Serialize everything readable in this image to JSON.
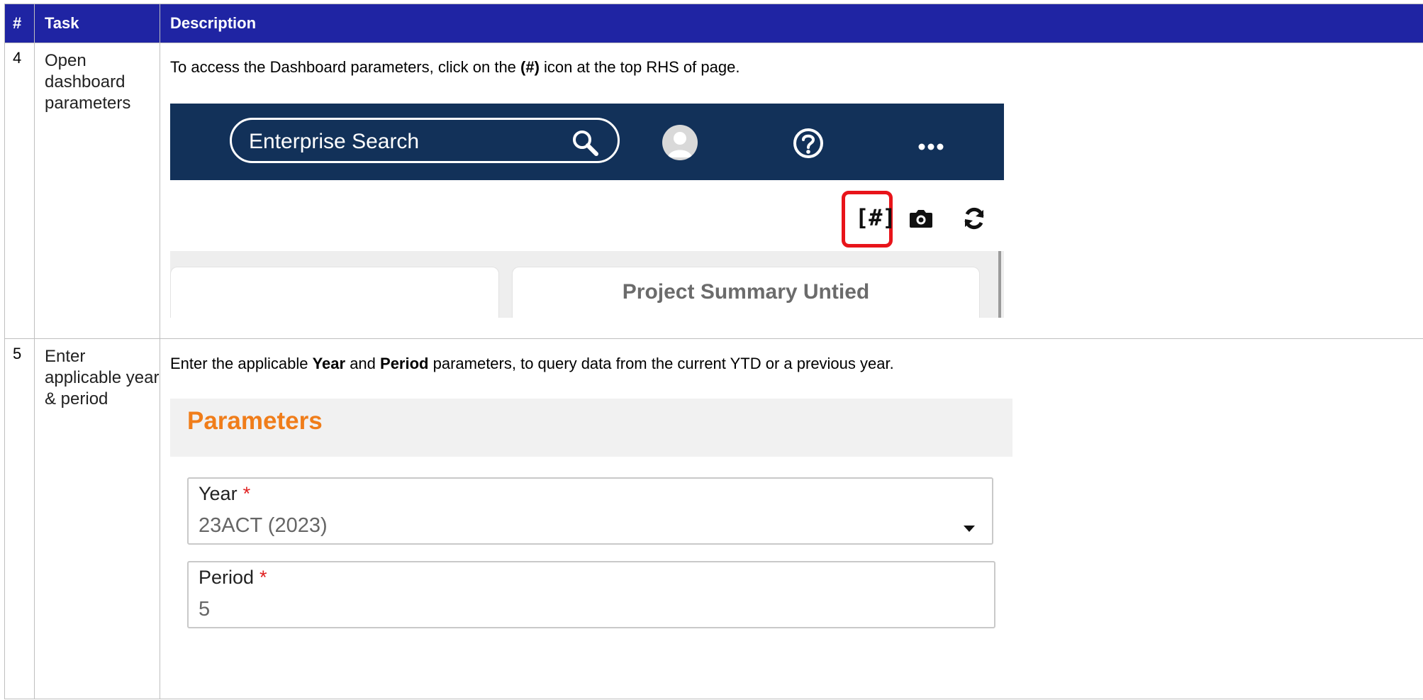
{
  "table": {
    "headers": {
      "num": "#",
      "task": "Task",
      "description": "Description"
    },
    "rows": [
      {
        "num": "4",
        "task": "Open dashboard parameters",
        "desc": {
          "pre": "To access the Dashboard parameters, click on the ",
          "bold": "(#)",
          "post": " icon at the top RHS of page."
        }
      },
      {
        "num": "5",
        "task": "Enter applicable year & period",
        "desc": {
          "pre": "Enter the applicable ",
          "bold1": "Year",
          "mid": " and ",
          "bold2": "Period",
          "post": " parameters, to query data from the current YTD or a previous year."
        }
      }
    ]
  },
  "shot1": {
    "search_placeholder": "Enterprise Search",
    "icons": {
      "search": "search-icon",
      "avatar": "user-avatar-icon",
      "help": "help-icon",
      "more": "more-icon",
      "params": "parameters-hash-icon",
      "snapshot": "camera-icon",
      "refresh": "refresh-icon"
    },
    "params_glyph": "[#]",
    "card_title": "Project Summary Untied",
    "colors": {
      "navbar": "#123159",
      "highlight": "#e8141a"
    }
  },
  "shot2": {
    "title": "Parameters",
    "year": {
      "label": "Year",
      "required_mark": "*",
      "value": "23ACT (2023)"
    },
    "period": {
      "label": "Period",
      "required_mark": "*",
      "value": "5"
    },
    "colors": {
      "title": "#f07d1a",
      "required": "#e02020"
    }
  }
}
